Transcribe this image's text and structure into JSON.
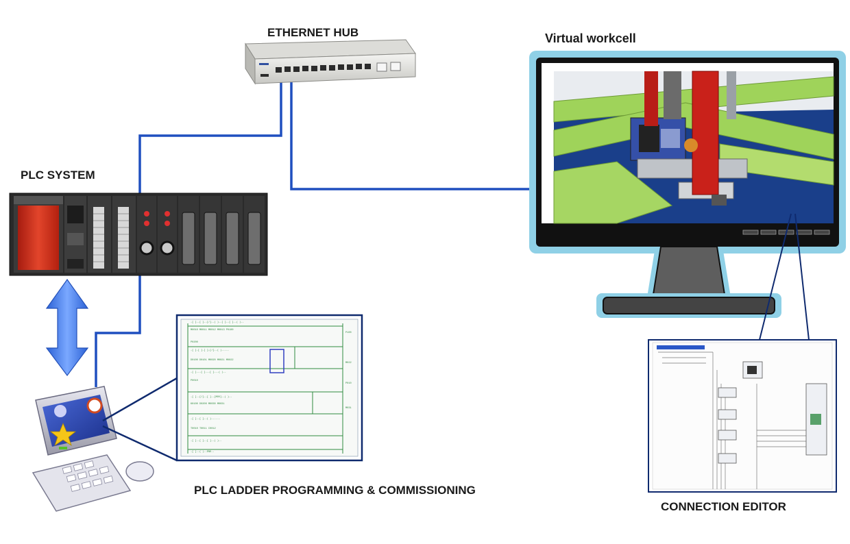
{
  "labels": {
    "ethernet_hub": "ETHERNET HUB",
    "virtual_workcell": "Virtual workcell",
    "plc_system": "PLC SYSTEM",
    "ladder": "PLC LADDER PROGRAMMING & COMMISSIONING",
    "connection_editor": "CONNECTION EDITOR"
  },
  "colors": {
    "cable_blue": "#1f4fbf",
    "plc_red": "#d8321c",
    "arrow_blue": "#4a7fe0",
    "monitor_glow": "#8fd0e6",
    "rail_green": "#9fd35a",
    "floor_blue": "#1a3f8a",
    "ladder_green": "#2f8a3f"
  },
  "icons": {
    "hub": "ethernet-hub-icon",
    "plc": "plc-rack-icon",
    "pc": "desktop-computer-icon",
    "monitor": "monitor-icon",
    "arrow": "double-arrow-icon"
  }
}
